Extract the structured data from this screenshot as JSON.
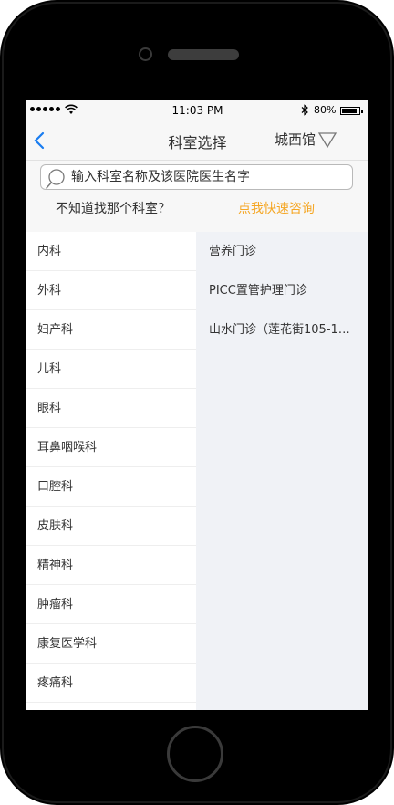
{
  "status_bar": {
    "signal": "●●●●●",
    "time": "11:03 PM",
    "battery_percent": "80%",
    "battery_level": 0.8
  },
  "nav": {
    "title": "科室选择",
    "branch_label": "城西馆",
    "back_icon": "chevron-left-icon",
    "accent_color": "#1a7df0"
  },
  "search": {
    "placeholder": "输入科室名称及该医院医生名字",
    "value": ""
  },
  "help": {
    "hint_text": "不知道找那个科室？",
    "consult_link": "点我快速咨询",
    "consult_color": "#f5a623"
  },
  "departments": [
    {
      "label": "内科"
    },
    {
      "label": "外科"
    },
    {
      "label": "妇产科"
    },
    {
      "label": "儿科"
    },
    {
      "label": "眼科"
    },
    {
      "label": "耳鼻咽喉科"
    },
    {
      "label": "口腔科"
    },
    {
      "label": "皮肤科"
    },
    {
      "label": "精神科"
    },
    {
      "label": "肿瘤科"
    },
    {
      "label": "康复医学科"
    },
    {
      "label": "疼痛科"
    }
  ],
  "clinics": [
    {
      "label": "营养门诊"
    },
    {
      "label": "PICC置管护理门诊"
    },
    {
      "label": "山水门诊（莲花街105-1…"
    }
  ]
}
